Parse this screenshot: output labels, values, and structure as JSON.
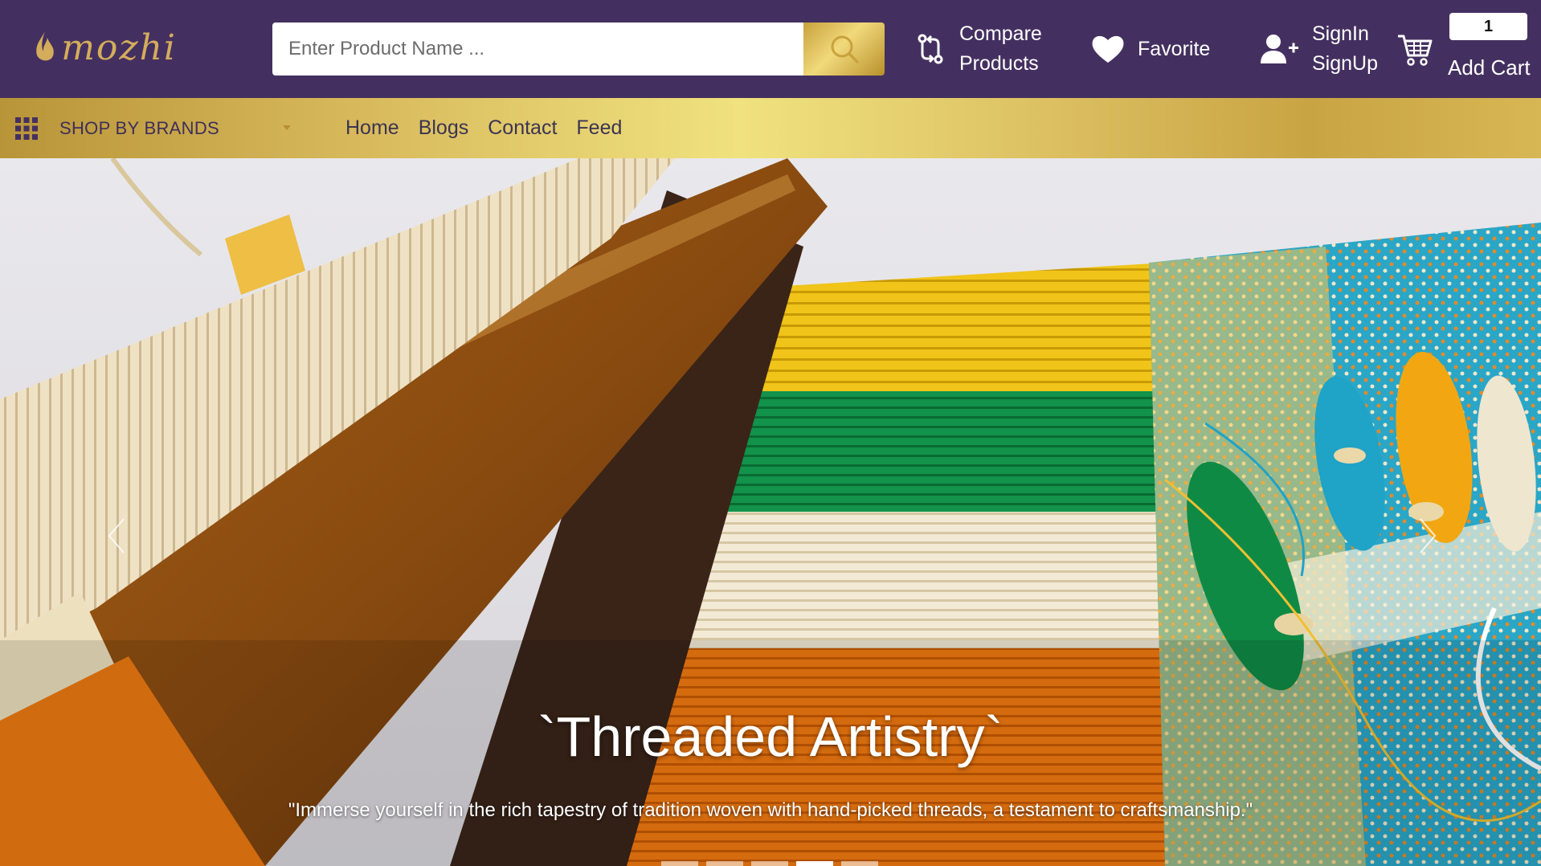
{
  "brand": {
    "logo_text": "mozhi"
  },
  "search": {
    "placeholder": "Enter Product Name ..."
  },
  "header": {
    "compare_line1": "Compare",
    "compare_line2": "Products",
    "favorite": "Favorite",
    "signin": "SignIn",
    "signup": "SignUp",
    "cart_count": "1",
    "cart_label": "Add Cart"
  },
  "nav": {
    "brands_label": "SHOP BY BRANDS",
    "links": [
      "Home",
      "Blogs",
      "Contact",
      "Feed"
    ]
  },
  "hero": {
    "title": "`Threaded Artistry`",
    "caption": "\"Immerse yourself in the rich tapestry of tradition woven with hand-picked threads, a testament to craftsmanship.\"",
    "slides": 5,
    "active_slide": 4
  },
  "colors": {
    "header_bg": "#443060",
    "gold_accent": "#d4ad5c",
    "navbar_gold": "#f0e27f",
    "nav_text": "#3c3452"
  },
  "icons": {
    "search": "search-icon",
    "compare": "compare-arrows-icon",
    "favorite": "heart-icon",
    "sign": "user-plus-icon",
    "cart": "shopping-cart-icon",
    "brands": "grid-icon",
    "prev": "chevron-left-icon",
    "next": "chevron-right-icon"
  }
}
